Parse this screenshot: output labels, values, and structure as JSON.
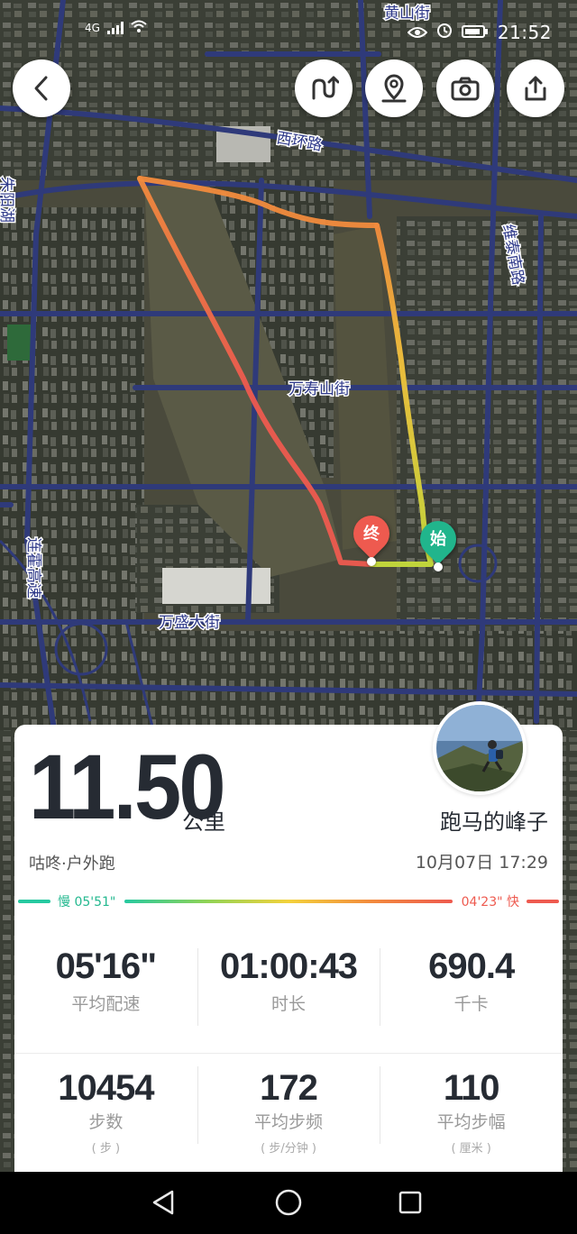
{
  "status_bar": {
    "time": "21:52",
    "network_label": "4G",
    "icons": [
      "eye-icon",
      "alarm-icon",
      "battery-icon",
      "signal-icon",
      "wifi-icon"
    ]
  },
  "toolbar": {
    "back_icon": "chevron-left-icon",
    "route_icon": "route-icon",
    "location_icon": "location-pin-icon",
    "camera_icon": "camera-icon",
    "share_icon": "share-icon"
  },
  "map": {
    "street_labels": [
      "黄山街",
      "西环路",
      "维泰南路",
      "万寿山街",
      "万盛大街",
      "连霍高速",
      "朱阳湖"
    ],
    "start_marker": "始",
    "end_marker": "终",
    "route_colors": [
      "#ee5a4f",
      "#f28b3d",
      "#f3d23c",
      "#c7dc3b"
    ]
  },
  "summary": {
    "distance": "11.50",
    "distance_unit": "公里",
    "run_type": "咕咚·户外跑",
    "username": "跑马的峰子",
    "datetime": "10月07日 17:29"
  },
  "pace_scale": {
    "slow_label": "慢 05'51\"",
    "fast_label": "04'23\" 快",
    "slow_color": "#27c9a0",
    "fast_color": "#ee5a4f"
  },
  "stats": [
    {
      "value": "05'16\"",
      "label": "平均配速",
      "sub": ""
    },
    {
      "value": "01:00:43",
      "label": "时长",
      "sub": ""
    },
    {
      "value": "690.4",
      "label": "千卡",
      "sub": ""
    }
  ],
  "stats2": [
    {
      "value": "10454",
      "label": "步数",
      "sub": "( 步 )"
    },
    {
      "value": "172",
      "label": "平均步频",
      "sub": "( 步/分钟 )"
    },
    {
      "value": "110",
      "label": "平均步幅",
      "sub": "( 厘米 )"
    }
  ],
  "nav": {
    "back_icon": "triangle-back-icon",
    "home_icon": "circle-home-icon",
    "recents_icon": "square-recents-icon"
  }
}
